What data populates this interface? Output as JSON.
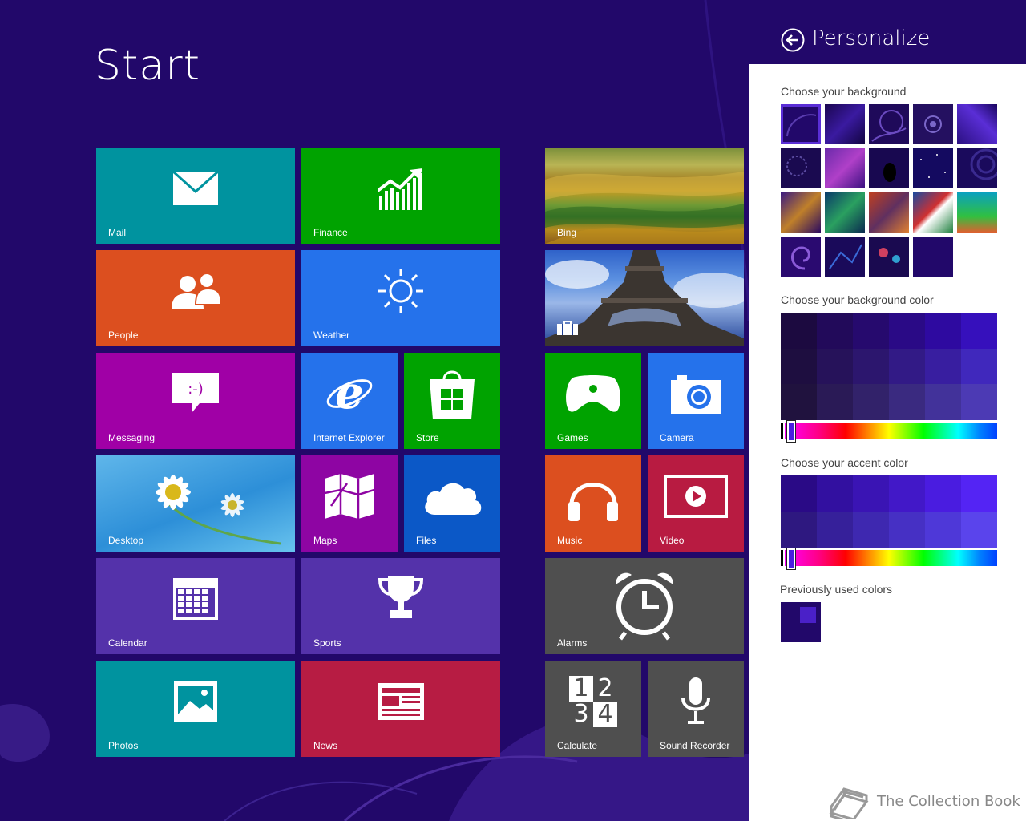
{
  "start": {
    "title": "Start",
    "tiles": {
      "mail": "Mail",
      "finance": "Finance",
      "bing": "Bing",
      "people": "People",
      "weather": "Weather",
      "messaging": "Messaging",
      "ie": "Internet Explorer",
      "store": "Store",
      "games": "Games",
      "camera": "Camera",
      "desktop": "Desktop",
      "maps": "Maps",
      "files": "Files",
      "music": "Music",
      "video": "Video",
      "calendar": "Calendar",
      "sports": "Sports",
      "alarms": "Alarms",
      "photos": "Photos",
      "news": "News",
      "calculate": "Calculate",
      "sound_recorder": "Sound Recorder"
    },
    "calc_digits": [
      "1",
      "2",
      "3",
      "4"
    ],
    "messaging_glyph": ":-)",
    "colors": {
      "background": "#22086a",
      "teal": "#00939f",
      "green": "#00a300",
      "orange": "#dc4f1f",
      "blue": "#2572eb",
      "purple": "#a000a6",
      "darkpurple": "#8e05a3",
      "darkblue": "#0b58c7",
      "violet": "#5432aa",
      "crimson": "#b81b41",
      "gray": "#4f4f4f",
      "red": "#b71c43"
    }
  },
  "panel": {
    "title": "Personalize",
    "background_heading": "Choose your background",
    "background_color_heading": "Choose your background color",
    "accent_color_heading": "Choose your accent color",
    "previous_heading": "Previously used colors",
    "background_color_value": "#22086a",
    "accent_color_value": "#4a1de0",
    "watermark": "The Collection Book"
  }
}
